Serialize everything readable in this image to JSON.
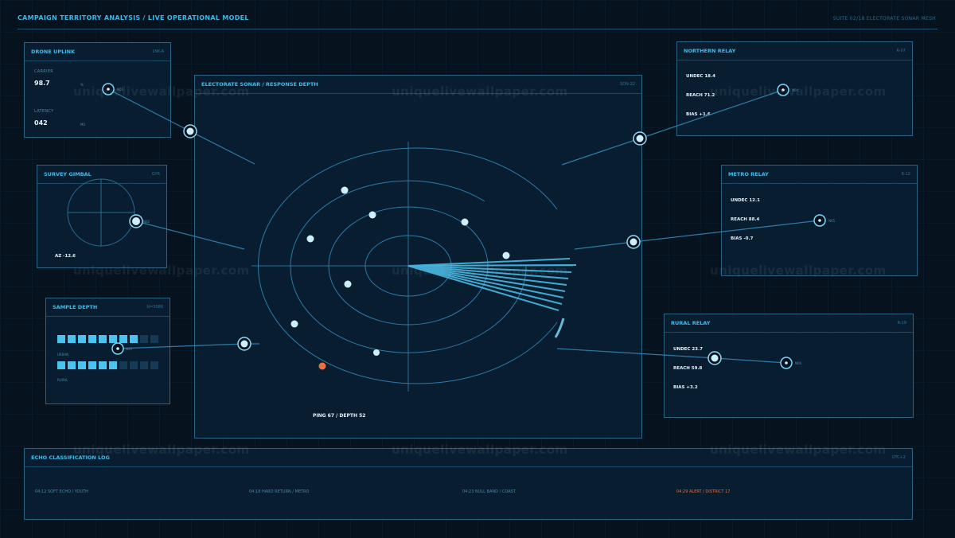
{
  "header": {
    "title": "CAMPAIGN TERRITORY ANALYSIS / LIVE OPERATIONAL MODEL",
    "suite": "SUITE 02/18 ELECTORATE SONAR MESH"
  },
  "drone_uplink": {
    "title": "DRONE UPLINK",
    "code": "LNK-A",
    "carrier_label": "CARRIER",
    "carrier_value": "98.7",
    "carrier_unit": "%",
    "latency_label": "LATENCY",
    "latency_value": "042",
    "latency_unit": "MS",
    "node_tag": "N01"
  },
  "survey_gimbal": {
    "title": "SURVEY GIMBAL",
    "code": "GYR",
    "azimuth": "AZ -12.6",
    "node_tag": "N02"
  },
  "sample_depth": {
    "title": "SAMPLE DEPTH",
    "code": "N=3086",
    "urban_label": "URBAN",
    "rural_label": "RURAL",
    "urban_level": 0.8,
    "rural_level": 0.6,
    "node_tag": "N03"
  },
  "sonar": {
    "title": "ELECTORATE SONAR / RESPONSE DEPTH",
    "code": "SON-22",
    "readout": "PING 67 / DEPTH 52"
  },
  "northern_relay": {
    "title": "NORTHERN RELAY",
    "code": "R-07",
    "undec": "UNDEC 18.4",
    "reach": "REACH 71.2",
    "bias": "BIAS +1.6",
    "node_tag": "N04"
  },
  "metro_relay": {
    "title": "METRO RELAY",
    "code": "R-12",
    "undec": "UNDEC 12.1",
    "reach": "REACH 88.4",
    "bias": "BIAS -0.7",
    "node_tag": "N05"
  },
  "rural_relay": {
    "title": "RURAL RELAY",
    "code": "R-19",
    "undec": "UNDEC 23.7",
    "reach": "REACH 59.8",
    "bias": "BIAS +3.2",
    "node_tag": "N06"
  },
  "echo_log": {
    "title": "ECHO CLASSIFICATION LOG",
    "code": "UTC+2",
    "entries": [
      {
        "text": "04:12 SOFT ECHO / YOUTH"
      },
      {
        "text": "04:18 HARD RETURN / METRO"
      },
      {
        "text": "04:23 NULL BAND / COAST"
      },
      {
        "text": "04:29 ALERT / DISTRICT 17"
      }
    ]
  },
  "watermark": "uniquelivewallpaper.com",
  "colors": {
    "background": "#06121d",
    "accent": "#38b8e8",
    "panel_border": "#2a6384",
    "alert": "#ec6e43"
  }
}
